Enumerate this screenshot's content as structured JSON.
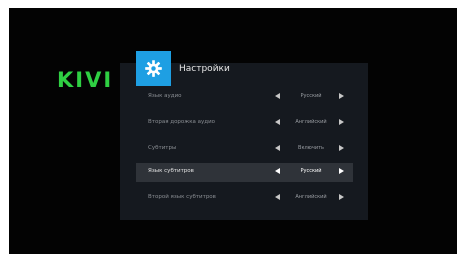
{
  "brand": {
    "logo_text": "KIVI",
    "logo_color": "#2fd043"
  },
  "panel": {
    "title": "Настройки",
    "header_icon": "gear-icon",
    "accent_color": "#1e9fe3",
    "items": [
      {
        "label": "Язык аудио",
        "value": "Русский",
        "selected": false
      },
      {
        "label": "Вторая дорожка аудио",
        "value": "Английский",
        "selected": false
      },
      {
        "label": "Субтитры",
        "value": "Включить",
        "selected": false
      },
      {
        "label": "Язык субтитров",
        "value": "Русский",
        "selected": true
      },
      {
        "label": "Второй язык субтитров",
        "value": "Английский",
        "selected": false
      }
    ]
  }
}
